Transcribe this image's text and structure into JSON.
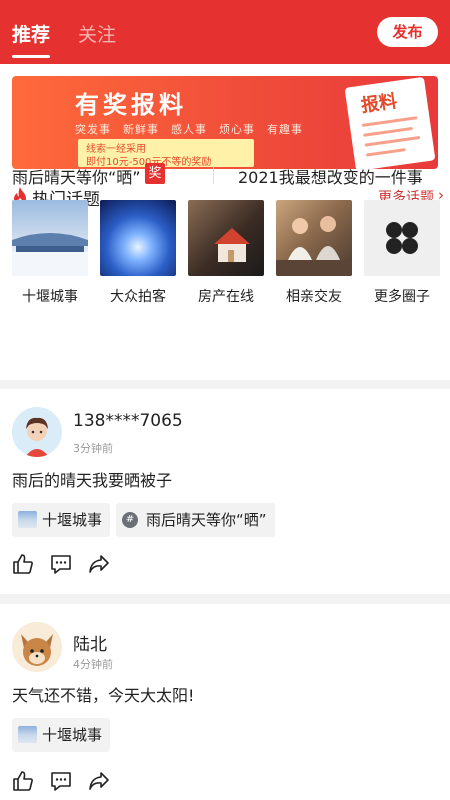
{
  "header": {
    "tabs": [
      {
        "label": "推荐",
        "active": true
      },
      {
        "label": "关注",
        "active": false
      }
    ],
    "publish_label": "发布",
    "brand_color": "#e5312f"
  },
  "banner": {
    "title": "有奖报料",
    "categories": "突发事　新鲜事　感人事　烦心事　有趣事",
    "line1": "线索一经采用",
    "line2": "即付10元-500元不等的奖励",
    "paper_title": "报料"
  },
  "hot_topics": {
    "title": "热门话题",
    "more_label": "更多话题",
    "icons": {
      "fire": "fire-icon",
      "more": "chevron-right-icon"
    },
    "topics": [
      {
        "label": "雨后晴天等你“晒”",
        "badge": "奖"
      },
      {
        "label": "2021我最想改变的一件事"
      }
    ]
  },
  "circles": [
    {
      "label": "十堰城事",
      "thumb": "snowy-building-photo"
    },
    {
      "label": "大众拍客",
      "thumb": "night-city-photo"
    },
    {
      "label": "房产在线",
      "thumb": "house-model-photo"
    },
    {
      "label": "相亲交友",
      "thumb": "couple-cafe-photo"
    },
    {
      "label": "更多圈子",
      "thumb": "four-dots-icon"
    }
  ],
  "posts": [
    {
      "user": "138****7065",
      "time": "3分钟前",
      "text": "雨后的晴天我要晒被子",
      "tags": [
        {
          "label": "十堰城事",
          "icon": "circle-thumb-icon"
        },
        {
          "label": "雨后晴天等你“晒”",
          "icon": "hashtag-icon"
        }
      ]
    },
    {
      "user": "陆北",
      "time": "4分钟前",
      "text": "天气还不错，今天大太阳!",
      "tags": [
        {
          "label": "十堰城事",
          "icon": "circle-thumb-icon"
        }
      ]
    }
  ],
  "actions": {
    "icons": [
      "thumbs-up-icon",
      "comment-icon",
      "share-icon"
    ]
  }
}
